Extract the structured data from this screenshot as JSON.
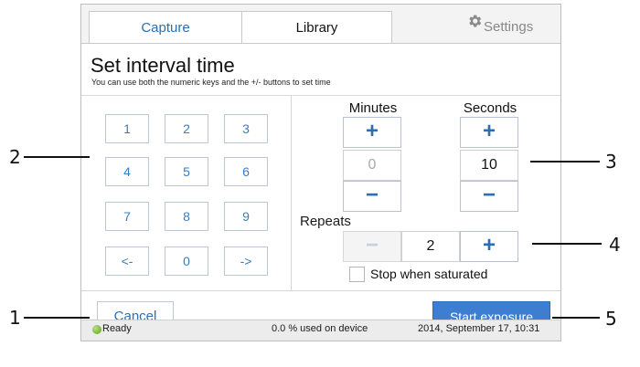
{
  "tabs": [
    {
      "label": "Capture",
      "active": true
    },
    {
      "label": "Library",
      "active": false
    }
  ],
  "settings_label": "Settings",
  "settings_icon": "gear-icon",
  "heading": {
    "title": "Set interval time",
    "subtitle": "You can use both the numeric keys and the +/- buttons to set time"
  },
  "keypad": {
    "keys": [
      "1",
      "2",
      "3",
      "4",
      "5",
      "6",
      "7",
      "8",
      "9",
      "<-",
      "0",
      "->"
    ]
  },
  "timer": {
    "minutes_label": "Minutes",
    "seconds_label": "Seconds",
    "plus": "+",
    "minus": "−",
    "minutes_value": "0",
    "seconds_value": "10"
  },
  "repeats": {
    "label": "Repeats",
    "value": "2",
    "minus": "−",
    "plus": "+"
  },
  "stop_checkbox": {
    "label": "Stop when saturated",
    "checked": false
  },
  "buttons": {
    "cancel": "Cancel",
    "start": "Start exposure"
  },
  "status": {
    "ready": "Ready",
    "usage": "0.0 % used on device",
    "datetime": "2014, September 17, 10:31"
  },
  "callouts": [
    "1",
    "2",
    "3",
    "4",
    "5"
  ],
  "colors": {
    "accent": "#3d7ed1",
    "link_blue": "#2a6fb3",
    "ready_green": "#5aa020"
  }
}
